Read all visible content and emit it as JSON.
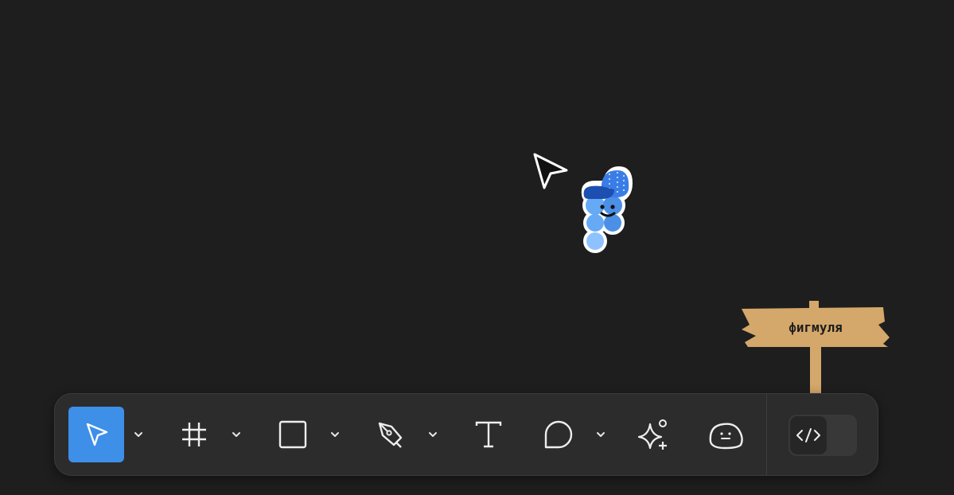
{
  "canvas": {
    "background": "#1e1e1e",
    "signpost_text": "фигмуля"
  },
  "toolbar": {
    "background": "#2c2c2c",
    "accent": "#3d8fe8",
    "tools": [
      {
        "name": "move",
        "icon": "cursor-arrow-icon",
        "active": true,
        "has_menu": true
      },
      {
        "name": "frame",
        "icon": "hash-frame-icon",
        "active": false,
        "has_menu": true
      },
      {
        "name": "rectangle",
        "icon": "square-icon",
        "active": false,
        "has_menu": true
      },
      {
        "name": "pen",
        "icon": "pen-nib-icon",
        "active": false,
        "has_menu": true
      },
      {
        "name": "text",
        "icon": "text-t-icon",
        "active": false,
        "has_menu": false
      },
      {
        "name": "comment",
        "icon": "speech-bubble-icon",
        "active": false,
        "has_menu": true
      },
      {
        "name": "actions",
        "icon": "sparkle-icon",
        "active": false,
        "has_menu": false
      },
      {
        "name": "figjam-character",
        "icon": "blob-face-icon",
        "active": false,
        "has_menu": false
      }
    ],
    "dev_mode": {
      "icon": "code-brackets-icon",
      "enabled": false
    }
  }
}
